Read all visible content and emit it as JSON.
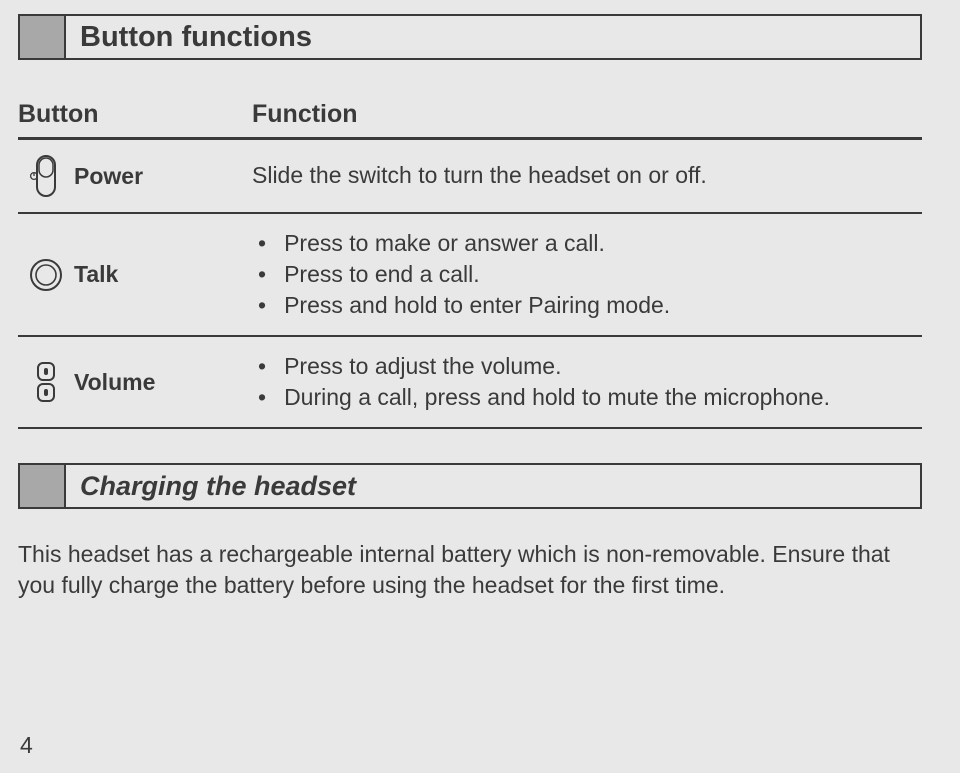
{
  "sections": {
    "button_functions_title": "Button functions",
    "charging_title": "Charging the headset"
  },
  "table": {
    "headers": {
      "button": "Button",
      "function": "Function"
    },
    "rows": [
      {
        "name": "Power",
        "icon": "power-switch-icon",
        "function_single": "Slide the switch to turn the headset on or off."
      },
      {
        "name": "Talk",
        "icon": "talk-button-icon",
        "function_list": [
          "Press to make or answer a call.",
          "Press to end a call.",
          "Press and hold to enter Pairing mode."
        ]
      },
      {
        "name": "Volume",
        "icon": "volume-buttons-icon",
        "function_list": [
          "Press to adjust the volume.",
          "During a call, press and hold to mute the microphone."
        ]
      }
    ]
  },
  "charging_paragraph": "This headset has a rechargeable internal battery which is non-removable. Ensure that you fully charge the battery before using the headset for the first time.",
  "page_number": "4"
}
